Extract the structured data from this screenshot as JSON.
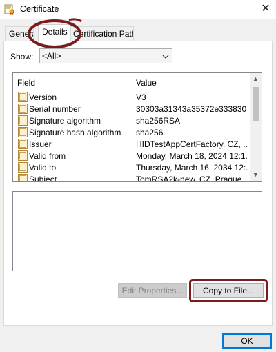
{
  "window": {
    "title": "Certificate",
    "close_glyph": "✕"
  },
  "tabs": [
    {
      "label": "General",
      "active": false
    },
    {
      "label": "Details",
      "active": true
    },
    {
      "label": "Certification Path",
      "active": false
    }
  ],
  "show": {
    "label": "Show:",
    "value": "<All>"
  },
  "list": {
    "headers": {
      "field": "Field",
      "value": "Value"
    },
    "rows": [
      {
        "field": "Version",
        "value": "V3"
      },
      {
        "field": "Serial number",
        "value": "30303a31343a35372e333830"
      },
      {
        "field": "Signature algorithm",
        "value": "sha256RSA"
      },
      {
        "field": "Signature hash algorithm",
        "value": "sha256"
      },
      {
        "field": "Issuer",
        "value": "HIDTestAppCertFactory, CZ, ..."
      },
      {
        "field": "Valid from",
        "value": "Monday, March 18, 2024 12:1..."
      },
      {
        "field": "Valid to",
        "value": "Thursday, March 16, 2034 12:..."
      },
      {
        "field": "Subject",
        "value": "TomRSA2k-new, CZ, Prague..."
      }
    ]
  },
  "buttons": {
    "edit_properties": "Edit Properties...",
    "copy_to_file": "Copy to File...",
    "ok": "OK"
  },
  "colors": {
    "annotation": "#7b1c1c",
    "accent": "#0078d7"
  },
  "icons": [
    "certificate-icon",
    "close-icon",
    "chevron-down-icon",
    "certificate-field-icon",
    "scroll-up-arrow-icon",
    "scroll-down-arrow-icon"
  ]
}
